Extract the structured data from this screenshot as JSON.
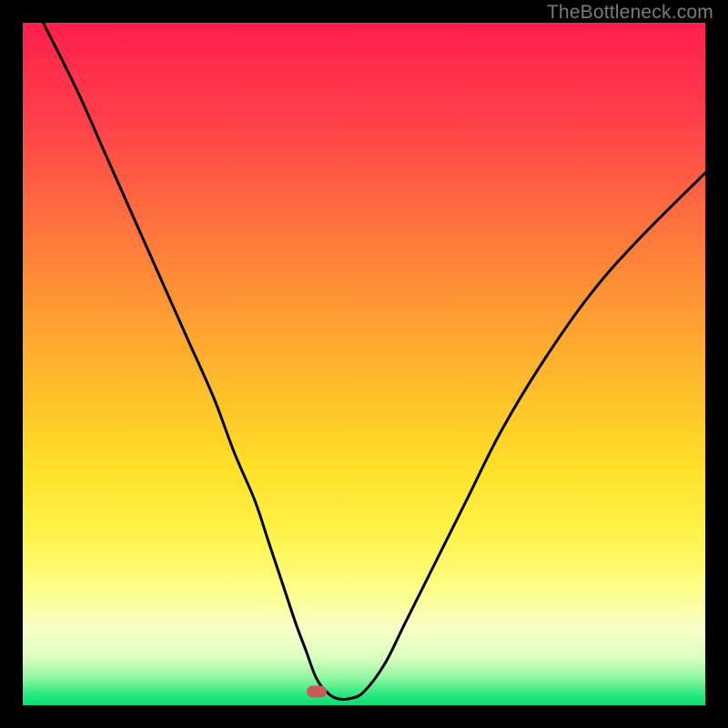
{
  "watermark": "TheBottleneck.com",
  "chart_data": {
    "type": "line",
    "title": "",
    "xlabel": "",
    "ylabel": "",
    "xlim": [
      0,
      100
    ],
    "ylim": [
      0,
      100
    ],
    "x": [
      3,
      8,
      12,
      16,
      20,
      24,
      28,
      31,
      34,
      36,
      38,
      40,
      41.5,
      43,
      44.5,
      46,
      48,
      50,
      53,
      56,
      60,
      65,
      70,
      76,
      83,
      90,
      100
    ],
    "values": [
      100,
      90,
      81,
      72,
      63,
      54,
      45,
      37,
      30,
      24,
      18,
      12,
      8,
      4,
      2,
      1,
      1,
      2,
      6,
      12,
      20,
      30,
      40,
      50,
      60,
      68,
      78
    ],
    "marker": {
      "x": 43,
      "y": 2
    },
    "baseline_y": 2,
    "gradient_stops": [
      {
        "pos": 0,
        "color": "#ff1f4c"
      },
      {
        "pos": 28,
        "color": "#ff6d3f"
      },
      {
        "pos": 55,
        "color": "#ffc22a"
      },
      {
        "pos": 75,
        "color": "#fff34a"
      },
      {
        "pos": 93,
        "color": "#dbffc0"
      },
      {
        "pos": 100,
        "color": "#0edc78"
      }
    ]
  }
}
